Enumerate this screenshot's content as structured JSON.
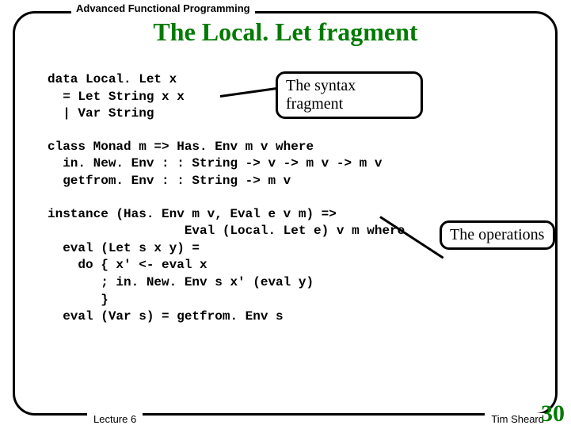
{
  "header_label": "Advanced Functional Programming",
  "title": "The Local. Let fragment",
  "code_block1": "data Local. Let x\n  = Let String x x\n  | Var String",
  "code_block2": "class Monad m => Has. Env m v where\n  in. New. Env : : String -> v -> m v -> m v\n  getfrom. Env : : String -> m v",
  "code_block3": "instance (Has. Env m v, Eval e v m) =>\n                  Eval (Local. Let e) v m where\n  eval (Let s x y) =\n    do { x' <- eval x\n       ; in. New. Env s x' (eval y)\n       }\n  eval (Var s) = getfrom. Env s",
  "callout1_text": "The syntax fragment",
  "callout2_text": "The operations",
  "footer_left": "Lecture 6",
  "footer_right": "Tim Sheard",
  "page_number": "30"
}
